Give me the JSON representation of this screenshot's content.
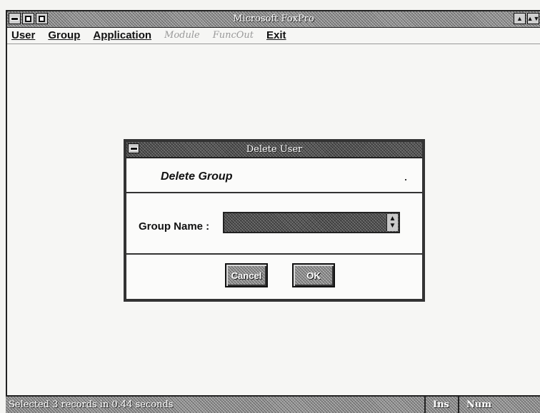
{
  "app": {
    "title": "Microsoft FoxPro"
  },
  "menu": {
    "items": [
      {
        "label": "User",
        "enabled": true
      },
      {
        "label": "Group",
        "enabled": true
      },
      {
        "label": "Application",
        "enabled": true
      },
      {
        "label": "Module",
        "enabled": false
      },
      {
        "label": "FuncOut",
        "enabled": false
      },
      {
        "label": "Exit",
        "enabled": true
      }
    ]
  },
  "dialog": {
    "title": "Delete User",
    "heading": "Delete Group",
    "field_label": "Group Name :",
    "group_name_value": "",
    "cancel_label": "Cancel",
    "ok_label": "OK"
  },
  "status": {
    "message": "Selected 3 records in 0.44 seconds",
    "ins": "Ins",
    "num": "Num"
  },
  "icons": {
    "system_menu": "system-menu-icon",
    "minimize": "minimize-icon",
    "maximize": "maximize-icon",
    "restore": "restore-icon",
    "combo_arrow": "updown-arrow-icon"
  }
}
